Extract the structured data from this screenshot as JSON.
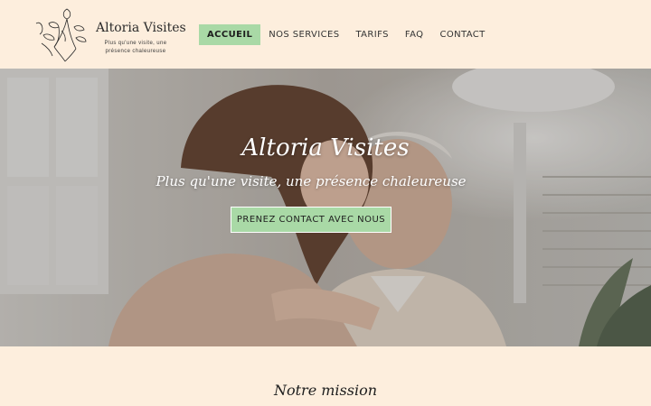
{
  "brand": {
    "name": "Altoria Visites",
    "tagline": "Plus qu'une visite, une présence chaleureuse"
  },
  "nav": {
    "items": [
      {
        "label": "ACCUEIL",
        "active": true
      },
      {
        "label": "NOS SERVICES",
        "active": false
      },
      {
        "label": "TARIFS",
        "active": false
      },
      {
        "label": "FAQ",
        "active": false
      },
      {
        "label": "CONTACT",
        "active": false
      }
    ]
  },
  "hero": {
    "title": "Altoria Visites",
    "subtitle": "Plus qu'une visite, une présence chaleureuse",
    "cta_label": "PRENEZ CONTACT AVEC NOUS",
    "image": "young woman hugging smiling elderly man"
  },
  "mission": {
    "title": "Notre mission"
  },
  "colors": {
    "background": "#fdeedd",
    "accent": "#a9d9a6",
    "text": "#333333"
  }
}
